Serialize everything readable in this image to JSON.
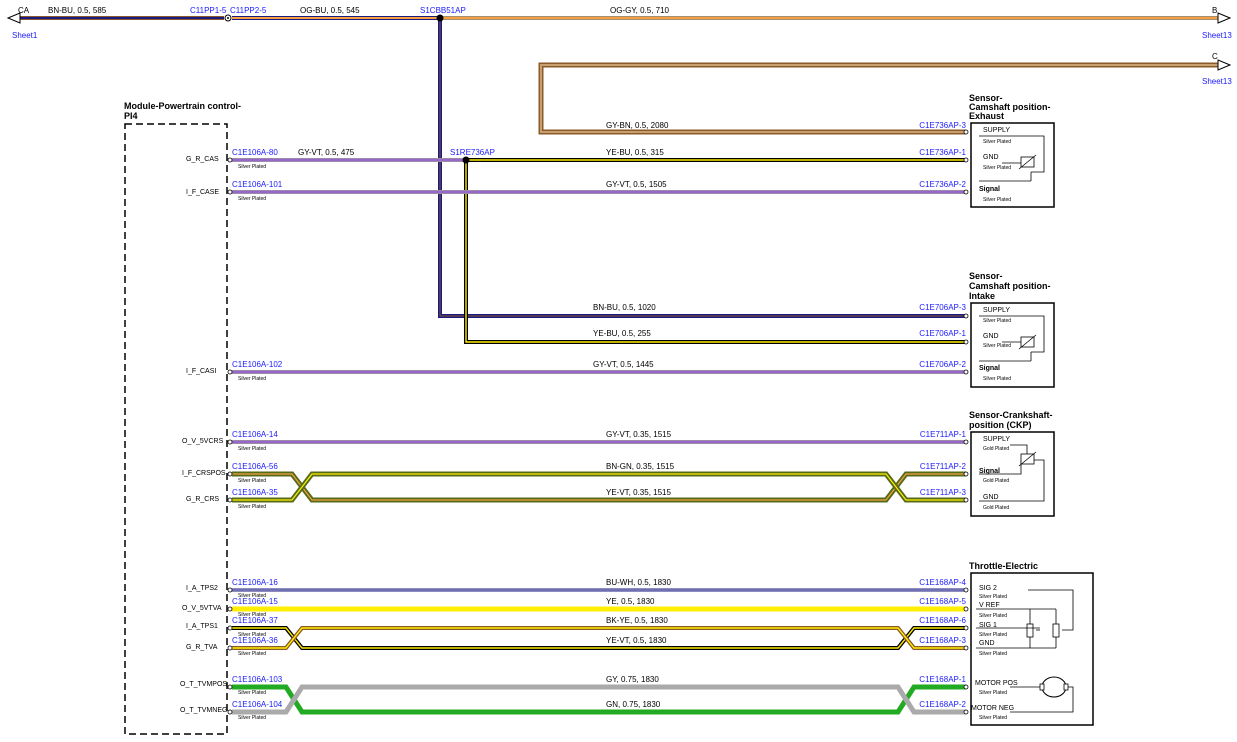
{
  "module": {
    "title_line1": "Module-Powertrain control-",
    "title_line2": "PI4"
  },
  "top": {
    "left_label": "CA",
    "left_sheet": "Sheet1",
    "wire1": "BN-BU,  0.5,  585",
    "conn1": "C11PP1-5",
    "conn2": "C11PP2-5",
    "wire2": "OG-BU,  0.5,  545",
    "splice": "S1CBB51AP",
    "wire3": "OG-GY,  0.5,  710",
    "right_b": "B",
    "sheet_b": "Sheet13",
    "right_c": "C",
    "sheet_c": "Sheet13",
    "wire_c": "GY-BN,  0.5,  2080"
  },
  "splice2": "S1RE736AP",
  "pins": [
    "G_R_CAS",
    "I_F_CASE",
    "I_F_CASI",
    "O_V_5VCRS",
    "I_F_CRSPOS",
    "G_R_CRS",
    "I_A_TPS2",
    "O_V_5VTVA",
    "I_A_TPS1",
    "G_R_TVA",
    "O_T_TVMPOS",
    "O_T_TVMNEG"
  ],
  "left_conns": [
    "C1E106A-80",
    "C1E106A-101",
    "C1E106A-102",
    "C1E106A-14",
    "C1E106A-56",
    "C1E106A-35",
    "C1E106A-16",
    "C1E106A-15",
    "C1E106A-37",
    "C1E106A-36",
    "C1E106A-103",
    "C1E106A-104"
  ],
  "plating": {
    "silver": "Silver Plated",
    "gold": "Gold Plated"
  },
  "wires": {
    "cas_short": "GY-VT,  0.5,  475",
    "ex_gnd": "YE-BU,  0.5,  315",
    "ex_sig": "GY-VT,  0.5,  1505",
    "in_sup": "BN-BU,  0.5,  1020",
    "in_gnd": "YE-BU,  0.5,  255",
    "in_sig": "GY-VT,  0.5,  1445",
    "ckp_sup": "GY-VT,  0.35,  1515",
    "ckp_sig": "BN-GN,  0.35,  1515",
    "ckp_gnd": "YE-VT,  0.35,  1515",
    "tps2": "BU-WH,  0.5,  1830",
    "vref": "YE,  0.5,  1830",
    "tps1": "BK-YE,  0.5,  1830",
    "tgnd": "YE-VT,  0.5,  1830",
    "mpos": "GY,  0.75,  1830",
    "mneg": "GN,  0.75,  1830"
  },
  "exhaust": {
    "title": [
      "Sensor-",
      "Camshaft position-",
      "Exhaust"
    ],
    "conns": [
      "C1E736AP-3",
      "C1E736AP-1",
      "C1E736AP-2"
    ],
    "pins": [
      "SUPPLY",
      "GND",
      "Signal"
    ]
  },
  "intake": {
    "title": [
      "Sensor-",
      "Camshaft position-",
      "Intake"
    ],
    "conns": [
      "C1E706AP-3",
      "C1E706AP-1",
      "C1E706AP-2"
    ],
    "pins": [
      "SUPPLY",
      "GND",
      "Signal"
    ]
  },
  "ckp": {
    "title": [
      "Sensor-Crankshaft-",
      "position (CKP)"
    ],
    "conns": [
      "C1E711AP-1",
      "C1E711AP-2",
      "C1E711AP-3"
    ],
    "pins": [
      "SUPPLY",
      "Signal",
      "GND"
    ]
  },
  "throttle": {
    "title": "Throttle-Electric",
    "conns": [
      "C1E168AP-4",
      "C1E168AP-5",
      "C1E168AP-6",
      "C1E168AP-3",
      "C1E168AP-1",
      "C1E168AP-2"
    ],
    "pins": [
      "SIG 2",
      "V REF",
      "SIG 1",
      "GND",
      "MOTOR POS",
      "MOTOR NEG"
    ]
  },
  "colors": {
    "blue": "#1a1aff",
    "brown": "#8b5a2b",
    "dark_blue": "#1a1a80",
    "orange": "#f4a040",
    "violet": "#9966cc",
    "yellow": "#ffee00",
    "olive": "#556b1a",
    "green": "#22aa22",
    "gray": "#aaaaaa"
  }
}
